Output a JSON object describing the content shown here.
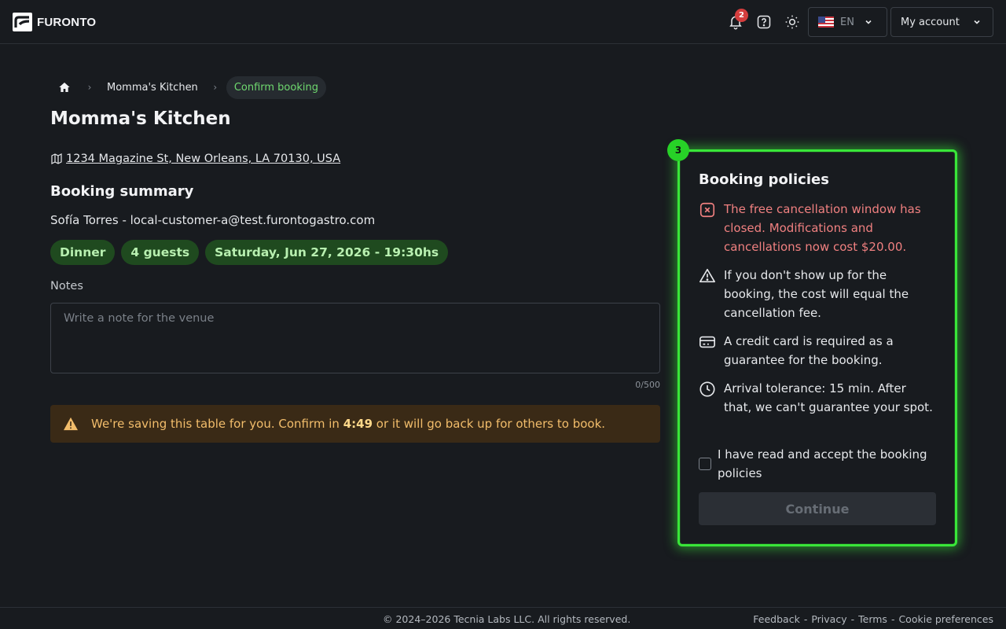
{
  "header": {
    "brand": "FURONTO",
    "notification_count": "2",
    "language": "EN",
    "account_label": "My account"
  },
  "breadcrumb": {
    "items": [
      "Momma's Kitchen",
      "Confirm booking"
    ]
  },
  "venue": {
    "name": "Momma's Kitchen",
    "address": "1234 Magazine St, New Orleans, LA 70130, USA"
  },
  "summary": {
    "heading": "Booking summary",
    "guest_line": "Sofía Torres - local-customer-a@test.furontogastro.com",
    "chips": [
      "Dinner",
      "4 guests",
      "Saturday, Jun 27, 2026 - 19:30hs"
    ]
  },
  "notes": {
    "label": "Notes",
    "placeholder": "Write a note for the venue",
    "value": "",
    "counter": "0/500"
  },
  "hold_alert": {
    "text_before": "We're saving this table for you. Confirm in ",
    "countdown": "4:49",
    "text_after": " or it will go back up for others to book."
  },
  "policies": {
    "step": "3",
    "heading": "Booking policies",
    "items": [
      {
        "icon": "x-square-icon",
        "text": "The free cancellation window has closed. Modifications and cancellations now cost $20.00."
      },
      {
        "icon": "warning-icon",
        "text": "If you don't show up for the booking, the cost will equal the cancellation fee."
      },
      {
        "icon": "credit-card-icon",
        "text": "A credit card is required as a guarantee for the booking."
      },
      {
        "icon": "clock-icon",
        "text": "Arrival tolerance: 15 min. After that, we can't guarantee your spot."
      }
    ],
    "accept_label": "I have read and accept the booking policies",
    "accepted": false,
    "continue_label": "Continue"
  },
  "footer": {
    "copyright": "© 2024–2026 Tecnia Labs LLC. All rights reserved.",
    "links": [
      "Feedback",
      "Privacy",
      "Terms",
      "Cookie preferences"
    ]
  },
  "colors": {
    "background": "#181b1f",
    "accent_green": "#39e639",
    "chip_bg": "#1f4a1f",
    "warning": "#f2bd6b",
    "danger": "#f08080"
  }
}
